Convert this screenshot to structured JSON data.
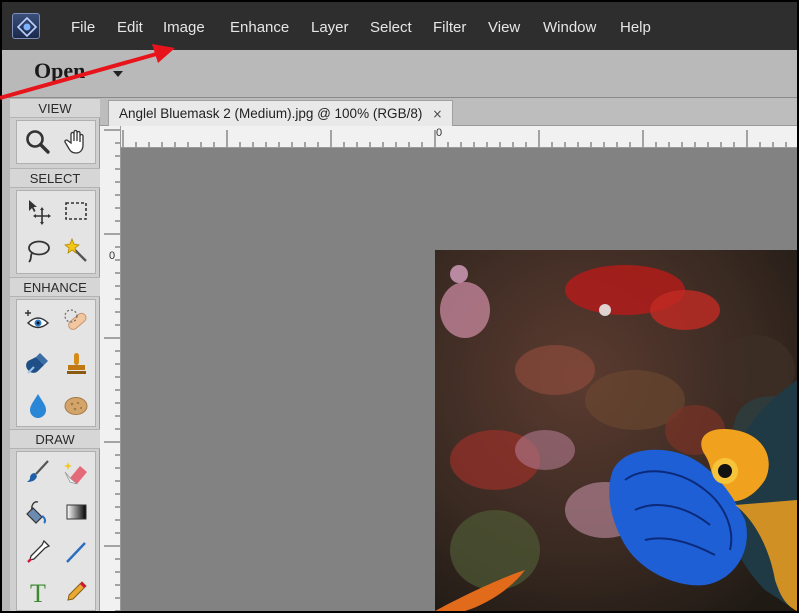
{
  "menu": {
    "items": [
      {
        "label": "File"
      },
      {
        "label": "Edit"
      },
      {
        "label": "Image"
      },
      {
        "label": "Enhance"
      },
      {
        "label": "Layer"
      },
      {
        "label": "Select"
      },
      {
        "label": "Filter"
      },
      {
        "label": "View"
      },
      {
        "label": "Window"
      },
      {
        "label": "Help"
      }
    ]
  },
  "options_bar": {
    "open_label": "Open"
  },
  "toolbox": {
    "sections": {
      "view": "VIEW",
      "select": "SELECT",
      "enhance": "ENHANCE",
      "draw": "DRAW"
    },
    "tools": {
      "view": [
        "zoom-tool-icon",
        "hand-tool-icon"
      ],
      "select": [
        "move-tool-icon",
        "marquee-tool-icon",
        "lasso-tool-icon",
        "magic-wand-icon"
      ],
      "enhance": [
        "red-eye-tool-icon",
        "spot-healing-icon",
        "smart-brush-icon",
        "clone-stamp-icon",
        "blur-tool-icon",
        "sponge-tool-icon"
      ],
      "draw": [
        "brush-tool-icon",
        "eraser-tool-icon",
        "paint-bucket-icon",
        "gradient-tool-icon",
        "eyedropper-tool-icon",
        "line-tool-icon",
        "type-tool-icon",
        "pencil-tool-icon"
      ]
    }
  },
  "document": {
    "tab_title": "Anglel Bluemask 2 (Medium).jpg @ 100% (RGB/8)",
    "tab_close": "×",
    "ruler_h_zero": "0",
    "ruler_v_zero": "0"
  },
  "colors": {
    "menubar": "#2e2e2e",
    "canvas": "#828282",
    "annotation_arrow": "#e8141b"
  }
}
